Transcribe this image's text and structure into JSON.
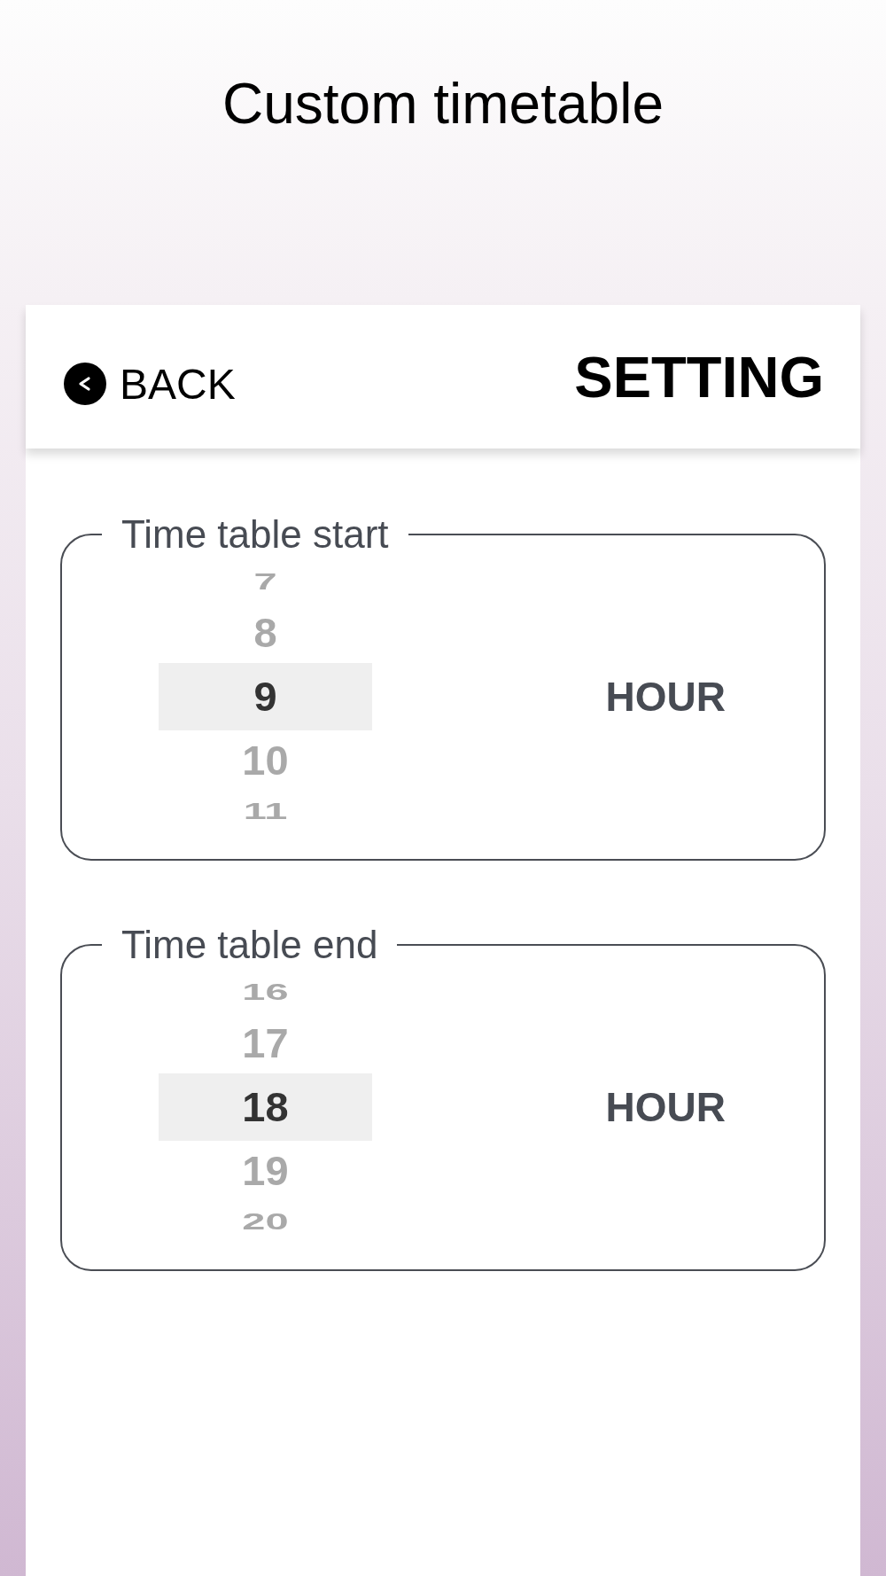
{
  "screen_title": "Custom timetable",
  "header": {
    "back_button": "BACK",
    "title": "SETTING"
  },
  "pickers": [
    {
      "legend": "Time table start",
      "unit": "HOUR",
      "options": [
        {
          "label": "7",
          "selected": false
        },
        {
          "label": "8",
          "selected": false
        },
        {
          "label": "9",
          "selected": true
        },
        {
          "label": "10",
          "selected": false
        },
        {
          "label": "11",
          "selected": false
        }
      ]
    },
    {
      "legend": "Time table end",
      "unit": "HOUR",
      "options": [
        {
          "label": "16",
          "selected": false
        },
        {
          "label": "17",
          "selected": false
        },
        {
          "label": "18",
          "selected": true
        },
        {
          "label": "19",
          "selected": false
        },
        {
          "label": "20",
          "selected": false
        }
      ]
    }
  ]
}
